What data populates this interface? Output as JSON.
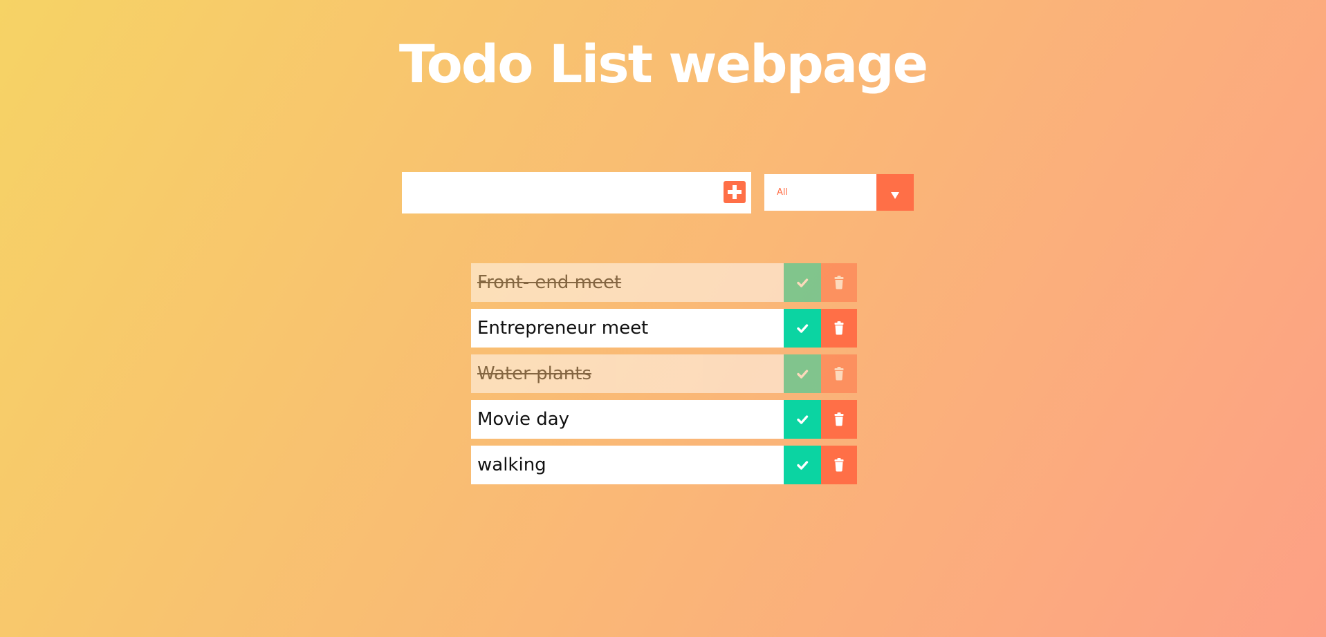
{
  "header": {
    "title": "Todo List webpage"
  },
  "form": {
    "input_value": "",
    "input_placeholder": "",
    "add_icon": "plus-square-icon",
    "filter_selected": "All",
    "filter_arrow_icon": "caret-down-icon"
  },
  "todos": [
    {
      "text": "Front- end meet",
      "completed": true
    },
    {
      "text": "Entrepreneur meet",
      "completed": false
    },
    {
      "text": "Water plants",
      "completed": true
    },
    {
      "text": "Movie day",
      "completed": false
    },
    {
      "text": "walking",
      "completed": false
    }
  ],
  "icons": {
    "complete": "check-icon",
    "delete": "trash-icon"
  },
  "colors": {
    "gradient_start": "#f6d365",
    "gradient_end": "#fda085",
    "accent": "#ff6f47",
    "complete": "#0bd4a2",
    "text": "#111111"
  }
}
